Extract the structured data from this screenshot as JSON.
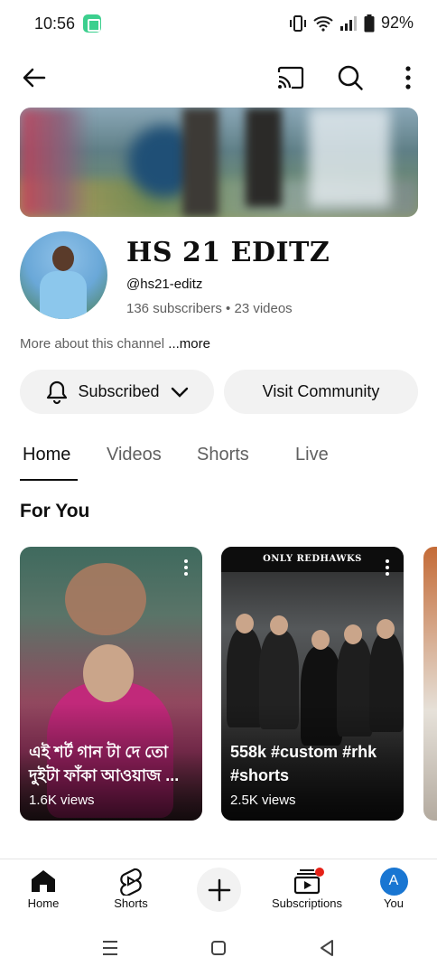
{
  "status": {
    "time": "10:56",
    "battery": "92%"
  },
  "topbar": {
    "back_icon": "arrow-left-icon",
    "cast_icon": "cast-icon",
    "search_icon": "search-icon",
    "more_icon": "more-vertical-icon"
  },
  "channel": {
    "name": "HS 21 EDITZ",
    "handle": "@hs21-editz",
    "stats": "136 subscribers • 23 videos",
    "about": "More about this channel",
    "about_more": "...more"
  },
  "actions": {
    "subscribed_label": "Subscribed",
    "community_label": "Visit Community"
  },
  "tabs": [
    {
      "label": "Home",
      "active": true
    },
    {
      "label": "Videos",
      "active": false
    },
    {
      "label": "Shorts",
      "active": false
    },
    {
      "label": "Live",
      "active": false
    }
  ],
  "section": {
    "title": "For You"
  },
  "shorts": [
    {
      "title": "এই শর্ট গান টা দে তো দুইটা ফাঁকা আওয়াজ ...",
      "views": "1.6K views"
    },
    {
      "title": "558k #custom #rhk #shorts",
      "views": "2.5K views",
      "banner": "ONLY REDHAWKS"
    }
  ],
  "bottom_nav": [
    {
      "label": "Home",
      "icon": "home-icon"
    },
    {
      "label": "Shorts",
      "icon": "shorts-icon"
    },
    {
      "label": "",
      "icon": "create-plus-icon"
    },
    {
      "label": "Subscriptions",
      "icon": "subscriptions-icon"
    },
    {
      "label": "You",
      "icon": "avatar-icon",
      "initial": "A"
    }
  ],
  "colors": {
    "accent": "#0f0f0f",
    "secondary_text": "#606060",
    "pill_bg": "#f2f2f2",
    "notification_dot": "#e62117",
    "avatar_you": "#1976d2"
  }
}
